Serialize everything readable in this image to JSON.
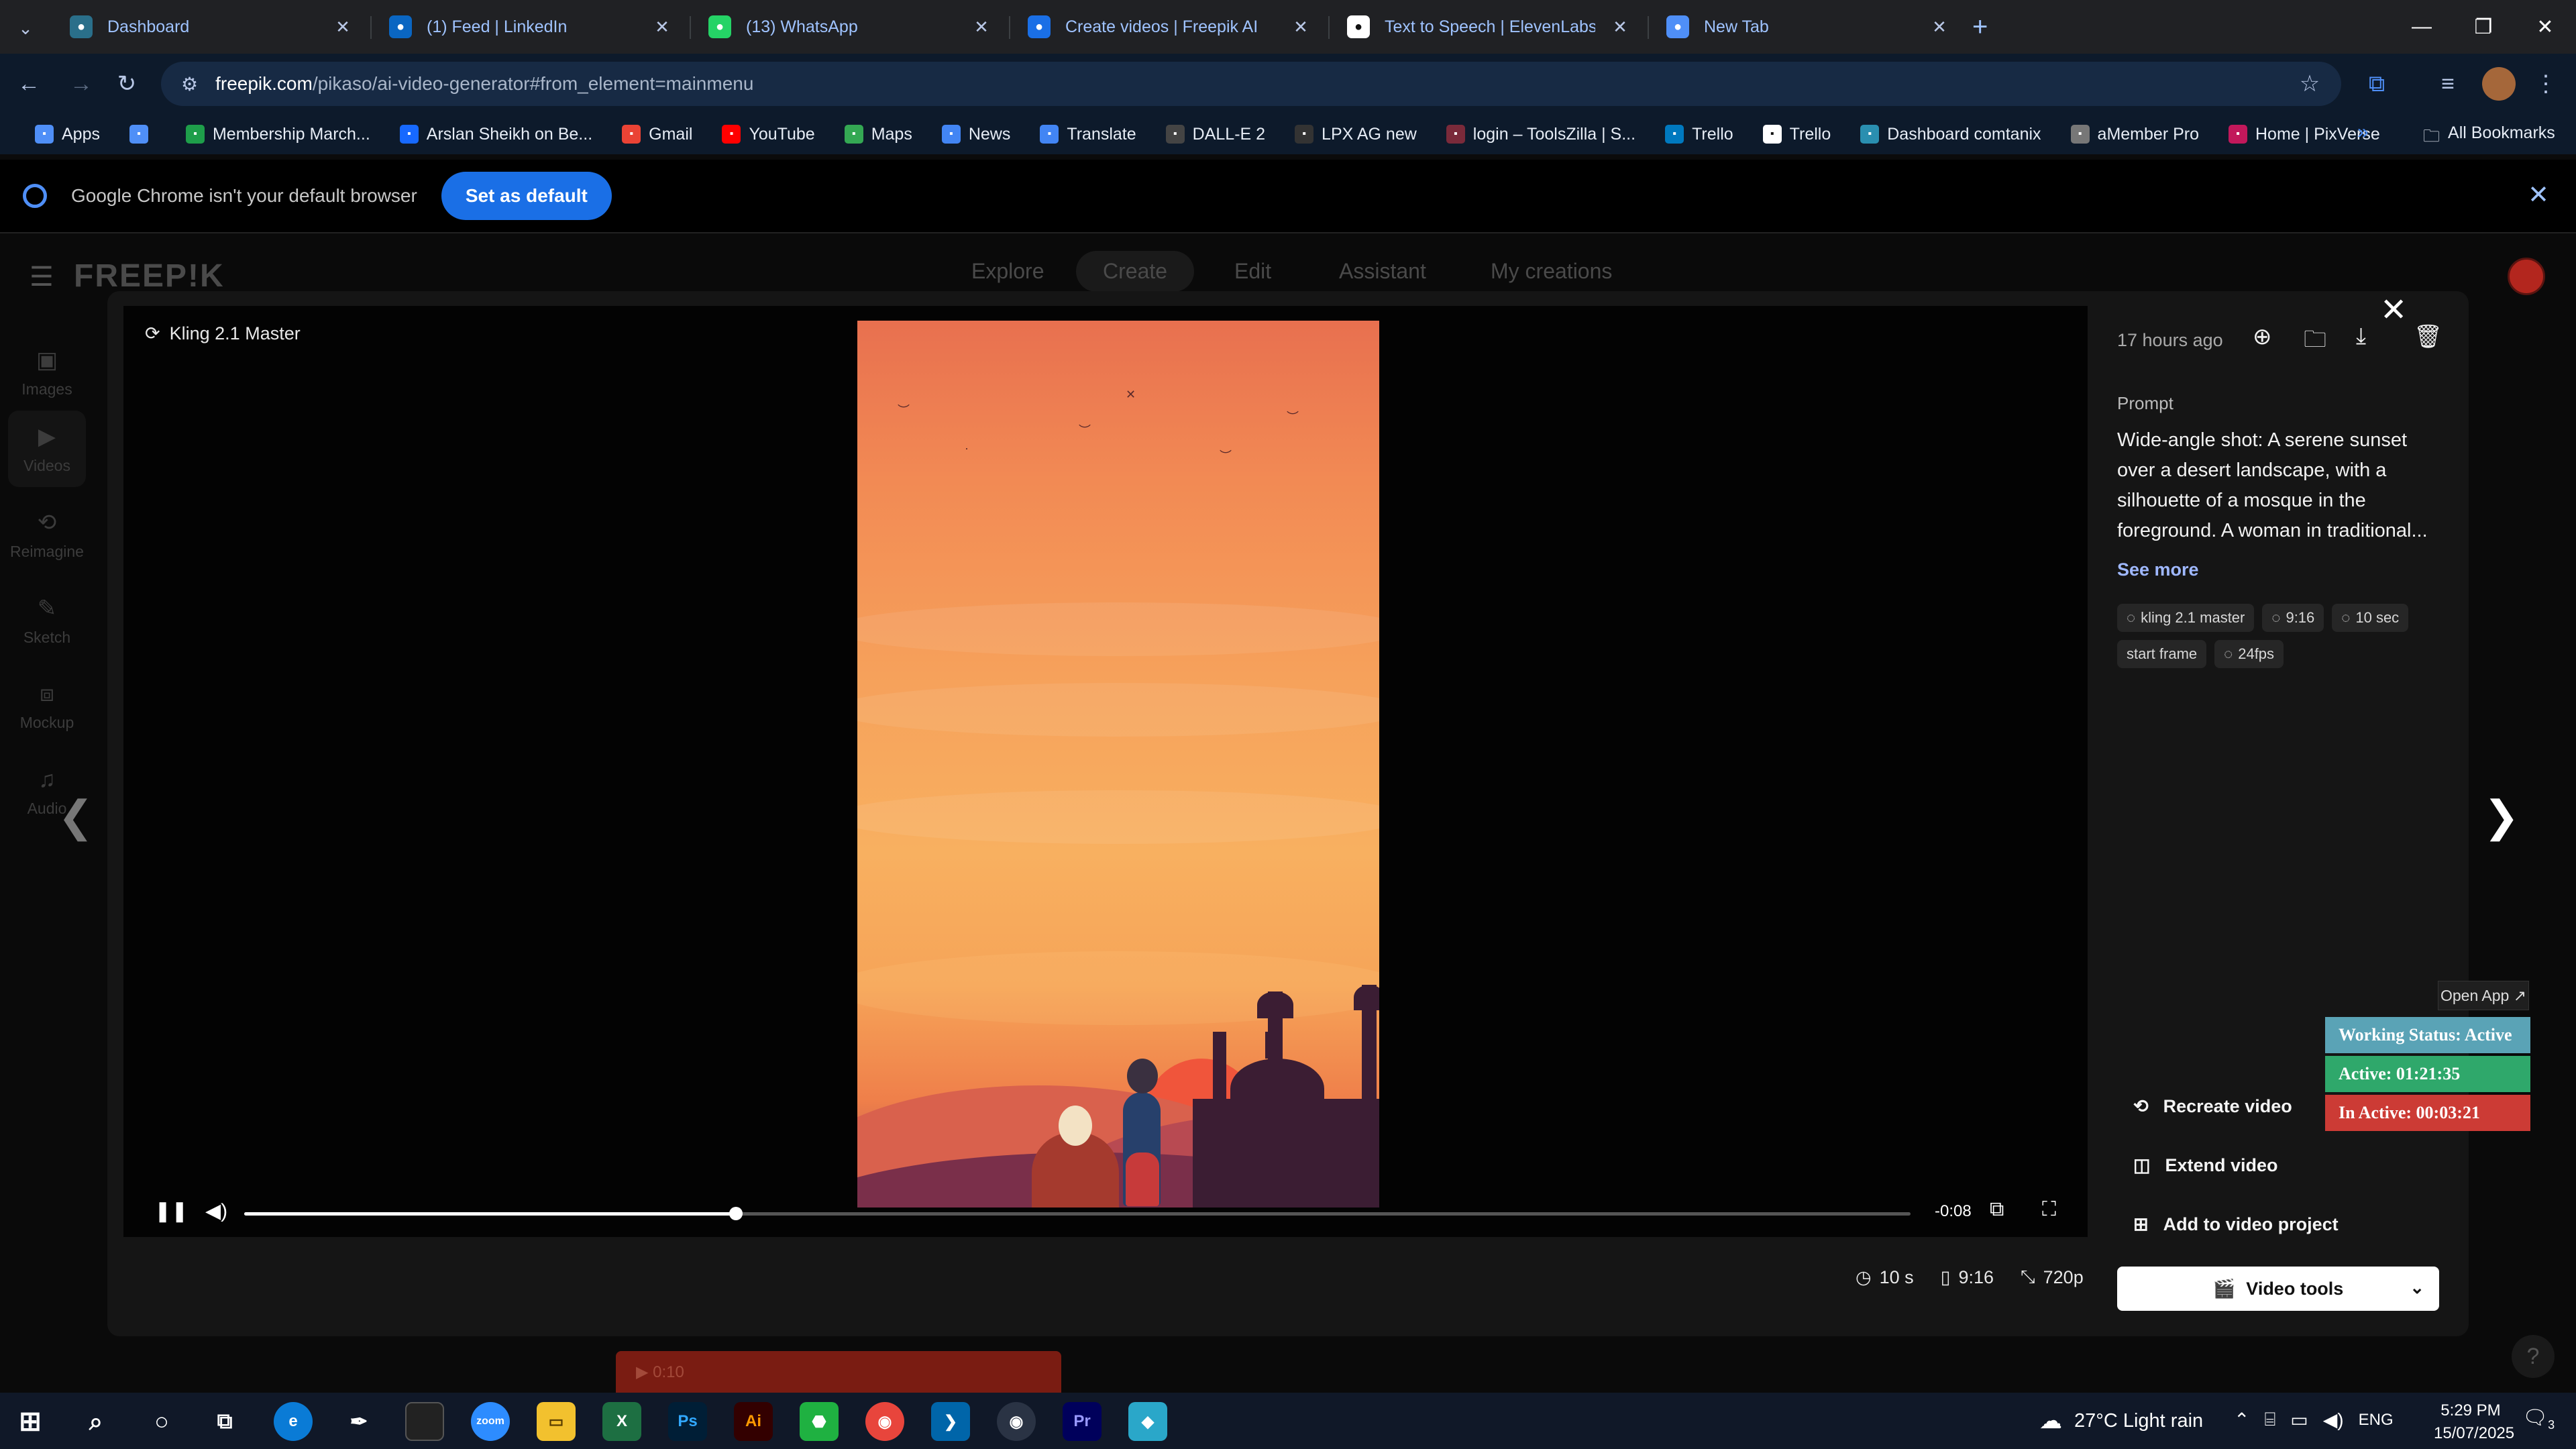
{
  "tabs": [
    {
      "label": "Dashboard",
      "icon": "dashboard-icon",
      "color": "#2a6f8a"
    },
    {
      "label": "(1) Feed | LinkedIn",
      "icon": "linkedin-icon",
      "color": "#0a66c2"
    },
    {
      "label": "(13) WhatsApp",
      "icon": "whatsapp-icon",
      "color": "#25d366"
    },
    {
      "label": "Create videos | Freepik AI",
      "icon": "freepik-icon",
      "color": "#1a6fe6"
    },
    {
      "label": "Text to Speech | ElevenLabs",
      "icon": "elevenlabs-icon",
      "color": "#ffffff"
    },
    {
      "label": "New Tab",
      "icon": "chrome-icon",
      "color": "#4f8ff7"
    }
  ],
  "address": {
    "host": "freepik.com",
    "path": "/pikaso/ai-video-generator#from_element=mainmenu"
  },
  "bookmarks": [
    {
      "label": "Apps",
      "icon": "apps-grid-icon",
      "color": "#4f8ff7"
    },
    {
      "label": "",
      "icon": "grid-icon",
      "color": "#4f8ff7"
    },
    {
      "label": "Membership March...",
      "icon": "membership-icon",
      "color": "#1e9e4a"
    },
    {
      "label": "Arslan Sheikh on Be...",
      "icon": "behance-icon",
      "color": "#1769ff"
    },
    {
      "label": "Gmail",
      "icon": "gmail-icon",
      "color": "#ea4335"
    },
    {
      "label": "YouTube",
      "icon": "youtube-icon",
      "color": "#ff0000"
    },
    {
      "label": "Maps",
      "icon": "maps-icon",
      "color": "#34a853"
    },
    {
      "label": "News",
      "icon": "news-icon",
      "color": "#4285f4"
    },
    {
      "label": "Translate",
      "icon": "translate-icon",
      "color": "#4285f4"
    },
    {
      "label": "DALL-E 2",
      "icon": "openai-icon",
      "color": "#444444"
    },
    {
      "label": "LPX AG new",
      "icon": "dash-icon",
      "color": "#333333"
    },
    {
      "label": "login – ToolsZilla | S...",
      "icon": "toolszilla-icon",
      "color": "#7a2a3a"
    },
    {
      "label": "Trello",
      "icon": "trello-icon",
      "color": "#0079bf"
    },
    {
      "label": "Trello",
      "icon": "trello-icon",
      "color": "#ffffff"
    },
    {
      "label": "Dashboard comtanix",
      "icon": "comtanix-icon",
      "color": "#2a8fb0"
    },
    {
      "label": "aMember Pro",
      "icon": "amember-icon",
      "color": "#777777"
    },
    {
      "label": "Home | PixVerse",
      "icon": "pixverse-icon",
      "color": "#c2185b"
    }
  ],
  "all_bookmarks": "All Bookmarks",
  "infobar": {
    "message": "Google Chrome isn't your default browser",
    "button": "Set as default"
  },
  "freepik": {
    "logo": "FREEP!K",
    "nav": [
      "Explore",
      "Create",
      "Edit",
      "Assistant",
      "My creations"
    ],
    "rail": [
      "Images",
      "Videos",
      "Reimagine",
      "Sketch",
      "Mockup",
      "Audio"
    ]
  },
  "modal": {
    "model_badge": "Kling 2.1 Master",
    "time_remaining": "-0:08",
    "progress": 0.295,
    "meta": {
      "duration": "10 s",
      "ratio": "9:16",
      "resolution": "720p"
    },
    "time_ago": "17 hours ago",
    "prompt_label": "Prompt",
    "prompt": "Wide-angle shot: A serene sunset over a desert landscape, with a silhouette of a mosque in the foreground. A woman in traditional...",
    "see_more": "See more",
    "tags": [
      {
        "label": "kling 2.1 master",
        "icon": "model-icon"
      },
      {
        "label": "9:16",
        "icon": "ratio-icon"
      },
      {
        "label": "10 sec",
        "icon": "clock-icon"
      },
      {
        "label": "start frame",
        "icon": ""
      },
      {
        "label": "24fps",
        "icon": "fps-icon"
      }
    ],
    "actions": {
      "recreate": "Recreate video",
      "extend": "Extend video",
      "add": "Add to video project"
    },
    "video_tools": "Video tools"
  },
  "behind_bar": "▶ 0:10",
  "widget": {
    "open_app": "Open App ↗",
    "status": "Working Status: Active",
    "active": "Active: 01:21:35",
    "inactive": "In Active: 00:03:21"
  },
  "taskbar": {
    "weather": "27°C  Light rain",
    "lang": "ENG",
    "time": "5:29 PM",
    "date": "15/07/2025",
    "notif_count": "3"
  }
}
